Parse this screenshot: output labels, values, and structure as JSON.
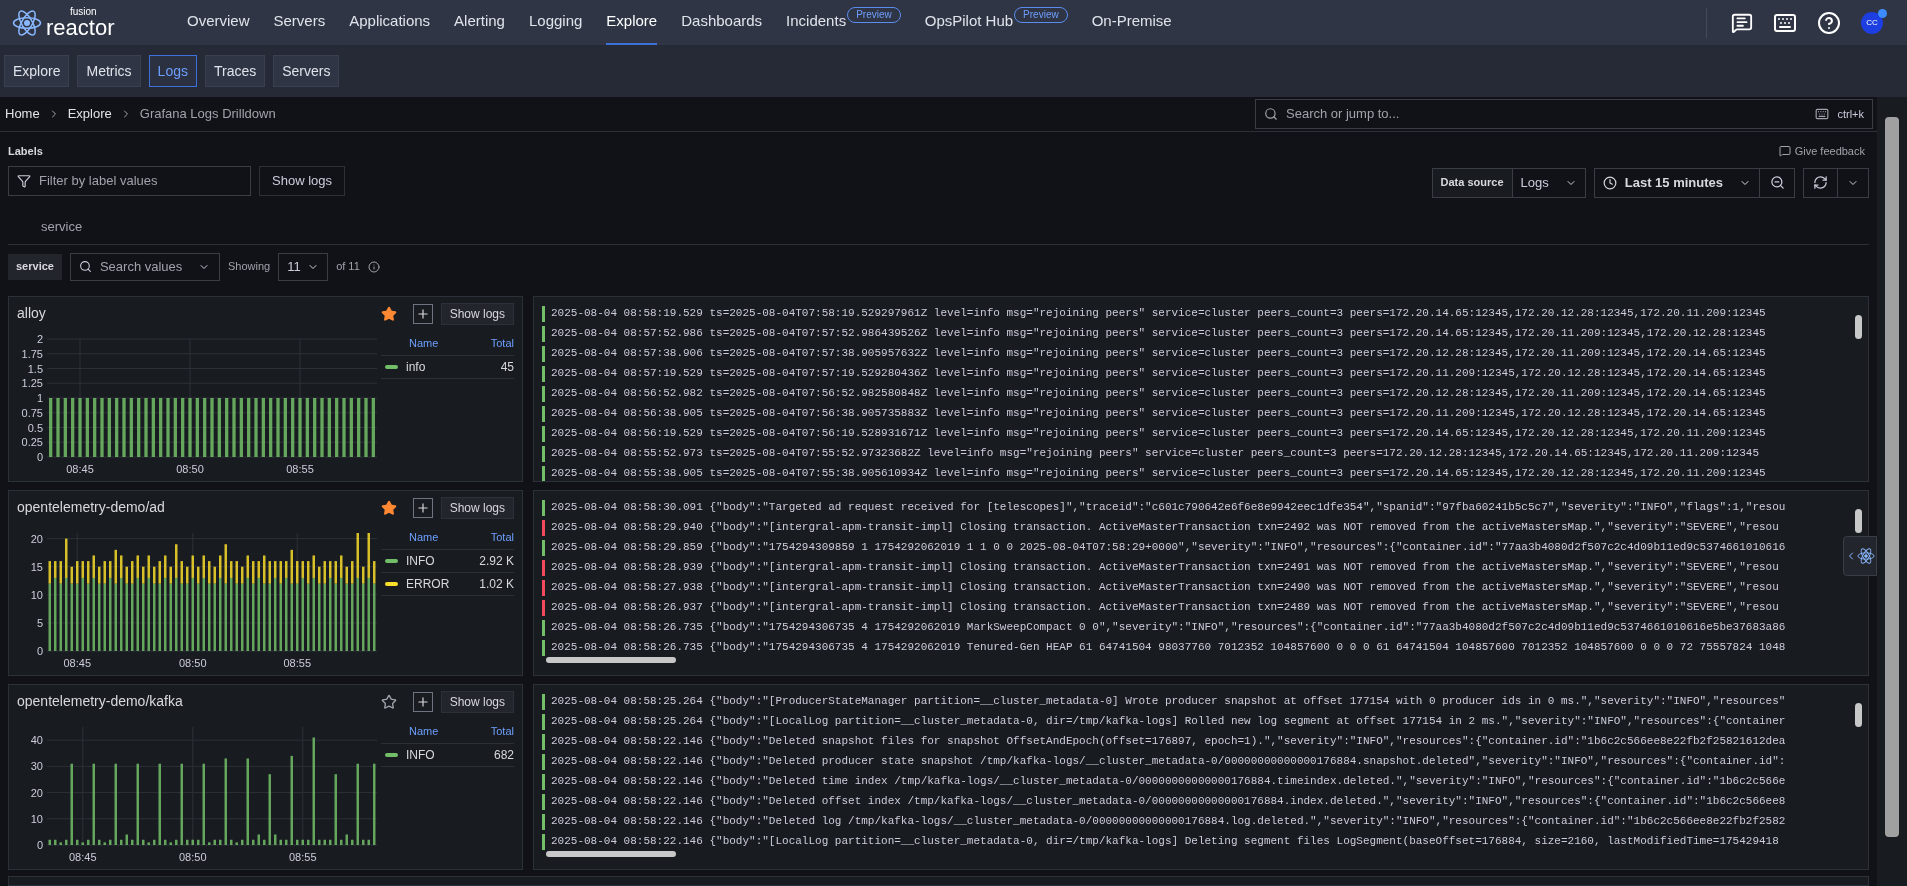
{
  "nav": {
    "logo": {
      "small": "fusion",
      "large": "reactor"
    },
    "items": [
      {
        "label": "Overview",
        "selected": false
      },
      {
        "label": "Servers",
        "selected": false
      },
      {
        "label": "Applications",
        "selected": false
      },
      {
        "label": "Alerting",
        "selected": false
      },
      {
        "label": "Logging",
        "selected": false
      },
      {
        "label": "Explore",
        "selected": true
      },
      {
        "label": "Dashboards",
        "selected": false
      },
      {
        "label": "Incidents",
        "selected": false,
        "badge": "Preview"
      },
      {
        "label": "OpsPilot Hub",
        "selected": false,
        "badge": "Preview"
      },
      {
        "label": "On-Premise",
        "selected": false
      }
    ],
    "avatar": "CC"
  },
  "subnav": [
    {
      "label": "Explore",
      "selected": false
    },
    {
      "label": "Metrics",
      "selected": false
    },
    {
      "label": "Logs",
      "selected": true
    },
    {
      "label": "Traces",
      "selected": false
    },
    {
      "label": "Servers",
      "selected": false
    }
  ],
  "breadcrumbs": [
    "Home",
    "Explore",
    "Grafana Logs Drilldown"
  ],
  "search": {
    "placeholder": "Search or jump to...",
    "shortcut": "ctrl+k"
  },
  "toolbar": {
    "labels_title": "Labels",
    "filter_placeholder": "Filter by label values",
    "show_logs": "Show logs",
    "feedback": "Give feedback",
    "data_source_label": "Data source",
    "data_source": "Logs",
    "time_range": "Last 15 minutes"
  },
  "label_tab": "service",
  "values_bar": {
    "label": "service",
    "search_placeholder": "Search values",
    "showing": "Showing",
    "count": "11",
    "of": "of 11"
  },
  "panels": [
    {
      "title": "alloy",
      "starred": true,
      "show_logs": "Show logs",
      "legend": {
        "columns": [
          "Name",
          "Total"
        ],
        "totals": [
          "45"
        ]
      },
      "chart_data": {
        "type": "bar",
        "stacked": true,
        "grid": true,
        "yticks": [
          0,
          0.25,
          0.5,
          0.75,
          1,
          1.25,
          1.5,
          1.75,
          2
        ],
        "ylim": [
          0,
          2
        ],
        "categories": [
          null,
          null,
          null,
          null,
          "08:45",
          null,
          null,
          null,
          null,
          null,
          null,
          null,
          null,
          null,
          null,
          null,
          null,
          null,
          null,
          "08:50",
          null,
          null,
          null,
          null,
          null,
          null,
          null,
          null,
          null,
          null,
          null,
          null,
          null,
          null,
          "08:55",
          null,
          null,
          null,
          null,
          null,
          null,
          null,
          null,
          null,
          null
        ],
        "series": [
          {
            "name": "info",
            "color": "#73bf69",
            "values": [
              1,
              1,
              1,
              1,
              1,
              1,
              1,
              1,
              1,
              1,
              1,
              1,
              1,
              1,
              1,
              1,
              1,
              1,
              1,
              1,
              1,
              1,
              1,
              1,
              1,
              1,
              1,
              1,
              1,
              1,
              1,
              1,
              1,
              1,
              1,
              1,
              1,
              1,
              1,
              1,
              1,
              1,
              1,
              1,
              1
            ]
          }
        ]
      },
      "logs": [
        {
          "text": "2025-08-04 08:58:19.529 ts=2025-08-04T07:58:19.529297961Z level=info msg=\"rejoining peers\" service=cluster peers_count=3 peers=172.20.14.65:12345,172.20.12.28:12345,172.20.11.209:12345",
          "color": "#73bf69"
        },
        {
          "text": "2025-08-04 08:57:52.986 ts=2025-08-04T07:57:52.986439526Z level=info msg=\"rejoining peers\" service=cluster peers_count=3 peers=172.20.14.65:12345,172.20.11.209:12345,172.20.12.28:12345",
          "color": "#73bf69"
        },
        {
          "text": "2025-08-04 08:57:38.906 ts=2025-08-04T07:57:38.905957632Z level=info msg=\"rejoining peers\" service=cluster peers_count=3 peers=172.20.12.28:12345,172.20.11.209:12345,172.20.14.65:12345",
          "color": "#73bf69"
        },
        {
          "text": "2025-08-04 08:57:19.529 ts=2025-08-04T07:57:19.529280436Z level=info msg=\"rejoining peers\" service=cluster peers_count=3 peers=172.20.11.209:12345,172.20.12.28:12345,172.20.14.65:12345",
          "color": "#73bf69"
        },
        {
          "text": "2025-08-04 08:56:52.982 ts=2025-08-04T07:56:52.982580848Z level=info msg=\"rejoining peers\" service=cluster peers_count=3 peers=172.20.12.28:12345,172.20.11.209:12345,172.20.14.65:12345",
          "color": "#73bf69"
        },
        {
          "text": "2025-08-04 08:56:38.905 ts=2025-08-04T07:56:38.905735883Z level=info msg=\"rejoining peers\" service=cluster peers_count=3 peers=172.20.11.209:12345,172.20.12.28:12345,172.20.14.65:12345",
          "color": "#73bf69"
        },
        {
          "text": "2025-08-04 08:56:19.529 ts=2025-08-04T07:56:19.528931671Z level=info msg=\"rejoining peers\" service=cluster peers_count=3 peers=172.20.14.65:12345,172.20.12.28:12345,172.20.11.209:12345",
          "color": "#73bf69"
        },
        {
          "text": "2025-08-04 08:55:52.973 ts=2025-08-04T07:55:52.97323682Z level=info msg=\"rejoining peers\" service=cluster peers_count=3 peers=172.20.12.28:12345,172.20.14.65:12345,172.20.11.209:12345",
          "color": "#73bf69"
        },
        {
          "text": "2025-08-04 08:55:38.905 ts=2025-08-04T07:55:38.905610934Z level=info msg=\"rejoining peers\" service=cluster peers_count=3 peers=172.20.14.65:12345,172.20.12.28:12345,172.20.11.209:12345",
          "color": "#73bf69"
        }
      ]
    },
    {
      "title": "opentelemetry-demo/ad",
      "starred": true,
      "show_logs": "Show logs",
      "legend": {
        "columns": [
          "Name",
          "Total"
        ],
        "totals": [
          "2.92 K",
          "1.02 K"
        ]
      },
      "chart_data": {
        "type": "bar",
        "stacked": true,
        "grid": true,
        "yticks": [
          0,
          5,
          10,
          15,
          20
        ],
        "ylim": [
          0,
          21
        ],
        "categories": [
          null,
          null,
          null,
          null,
          null,
          "08:45",
          null,
          null,
          null,
          null,
          null,
          null,
          null,
          null,
          null,
          null,
          null,
          null,
          null,
          null,
          null,
          null,
          null,
          null,
          null,
          null,
          "08:50",
          null,
          null,
          null,
          null,
          null,
          null,
          null,
          null,
          null,
          null,
          null,
          null,
          null,
          null,
          null,
          null,
          null,
          null,
          "08:55",
          null,
          null,
          null,
          null,
          null,
          null,
          null,
          null,
          null,
          null,
          null,
          null,
          null,
          null
        ],
        "series": [
          {
            "name": "INFO",
            "color": "#73bf69",
            "values": [
              12,
              13,
              12,
              13,
              12,
              12,
              13,
              12,
              13,
              12,
              12,
              13,
              12,
              13,
              12,
              12,
              13,
              12,
              13,
              12,
              12,
              13,
              12,
              13,
              12,
              12,
              13,
              12,
              13,
              12,
              12,
              13,
              12,
              13,
              12,
              12,
              13,
              12,
              13,
              12,
              12,
              13,
              12,
              13,
              12,
              12,
              13,
              12,
              13,
              12,
              12,
              13,
              12,
              13,
              12,
              12,
              13,
              12,
              13,
              12
            ]
          },
          {
            "name": "ERROR",
            "color": "#fade2a",
            "values": [
              4,
              3,
              4,
              7,
              3,
              4,
              3,
              4,
              4,
              3,
              4,
              3,
              6,
              4,
              3,
              4,
              4,
              3,
              4,
              3,
              4,
              4,
              3,
              6,
              4,
              3,
              4,
              3,
              4,
              4,
              3,
              4,
              7,
              3,
              4,
              3,
              4,
              4,
              3,
              5,
              4,
              3,
              4,
              3,
              6,
              4,
              3,
              4,
              4,
              3,
              4,
              3,
              4,
              4,
              3,
              4,
              8,
              3,
              8,
              4
            ]
          }
        ]
      },
      "logs": [
        {
          "text": "2025-08-04 08:58:30.091 {\"body\":\"Targeted ad request received for [telescopes]\",\"traceid\":\"c601c790642e6f6e8e9942eec1dfe354\",\"spanid\":\"97fba60241b5c5c7\",\"severity\":\"INFO\",\"flags\":1,\"resou",
          "color": "#73bf69"
        },
        {
          "text": "2025-08-04 08:58:29.940 {\"body\":\"[intergral-apm-transit-impl] Closing transaction. ActiveMasterTransaction txn=2492 was NOT removed from the activeMastersMap.\",\"severity\":\"SEVERE\",\"resou",
          "color": "#f2495c"
        },
        {
          "text": "2025-08-04 08:58:29.859 {\"body\":\"1754294309859 1 1754292062019 1 1 0 0 2025-08-04T07:58:29+0000\",\"severity\":\"INFO\",\"resources\":{\"container.id\":\"77aa3b4080d2f507c2c4d09b11ed9c5374661010616",
          "color": "#73bf69"
        },
        {
          "text": "2025-08-04 08:58:28.939 {\"body\":\"[intergral-apm-transit-impl] Closing transaction. ActiveMasterTransaction txn=2491 was NOT removed from the activeMastersMap.\",\"severity\":\"SEVERE\",\"resou",
          "color": "#f2495c"
        },
        {
          "text": "2025-08-04 08:58:27.938 {\"body\":\"[intergral-apm-transit-impl] Closing transaction. ActiveMasterTransaction txn=2490 was NOT removed from the activeMastersMap.\",\"severity\":\"SEVERE\",\"resou",
          "color": "#f2495c"
        },
        {
          "text": "2025-08-04 08:58:26.937 {\"body\":\"[intergral-apm-transit-impl] Closing transaction. ActiveMasterTransaction txn=2489 was NOT removed from the activeMastersMap.\",\"severity\":\"SEVERE\",\"resou",
          "color": "#f2495c"
        },
        {
          "text": "2025-08-04 08:58:26.735 {\"body\":\"1754294306735 4 1754292062019 MarkSweepCompact 0 0\",\"severity\":\"INFO\",\"resources\":{\"container.id\":\"77aa3b4080d2f507c2c4d09b11ed9c5374661010616e5be37683a86",
          "color": "#73bf69"
        },
        {
          "text": "2025-08-04 08:58:26.735 {\"body\":\"1754294306735 4 1754292062019 Tenured-Gen HEAP 61 64741504 98037760 7012352 104857600 0 0 0 61 64741504 104857600 7012352 104857600 0 0 0 72 75557824 1048",
          "color": "#73bf69"
        }
      ]
    },
    {
      "title": "opentelemetry-demo/kafka",
      "starred": false,
      "show_logs": "Show logs",
      "legend": {
        "columns": [
          "Name",
          "Total"
        ],
        "totals": [
          "682"
        ]
      },
      "chart_data": {
        "type": "bar",
        "stacked": true,
        "grid": true,
        "yticks": [
          0,
          10,
          20,
          30,
          40
        ],
        "ylim": [
          0,
          45
        ],
        "categories": [
          null,
          null,
          null,
          null,
          null,
          null,
          "08:45",
          null,
          null,
          null,
          null,
          null,
          null,
          null,
          null,
          null,
          null,
          null,
          null,
          null,
          null,
          null,
          null,
          null,
          null,
          null,
          "08:50",
          null,
          null,
          null,
          null,
          null,
          null,
          null,
          null,
          null,
          null,
          null,
          null,
          null,
          null,
          null,
          null,
          null,
          null,
          null,
          "08:55",
          null,
          null,
          null,
          null,
          null,
          null,
          null,
          null,
          null,
          null,
          null,
          null,
          null
        ],
        "series": [
          {
            "name": "INFO",
            "color": "#73bf69",
            "values": [
              2,
              2,
              1,
              2,
              31,
              2,
              1,
              2,
              31,
              2,
              1,
              2,
              31,
              2,
              4,
              2,
              31,
              2,
              1,
              2,
              31,
              2,
              1,
              2,
              31,
              2,
              2,
              2,
              31,
              1,
              2,
              2,
              33,
              2,
              1,
              2,
              33,
              2,
              4,
              2,
              27,
              4,
              2,
              2,
              34,
              2,
              2,
              2,
              41,
              2,
              2,
              2,
              27,
              2,
              4,
              2,
              31,
              2,
              2,
              31
            ]
          }
        ]
      },
      "logs": [
        {
          "text": "2025-08-04 08:58:25.264 {\"body\":\"[ProducerStateManager partition=__cluster_metadata-0] Wrote producer snapshot at offset 177154 with 0 producer ids in 0 ms.\",\"severity\":\"INFO\",\"resources\"",
          "color": "#73bf69"
        },
        {
          "text": "2025-08-04 08:58:25.264 {\"body\":\"[LocalLog partition=__cluster_metadata-0, dir=/tmp/kafka-logs] Rolled new log segment at offset 177154 in 2 ms.\",\"severity\":\"INFO\",\"resources\":{\"container",
          "color": "#73bf69"
        },
        {
          "text": "2025-08-04 08:58:22.146 {\"body\":\"Deleted snapshot files for snapshot OffsetAndEpoch(offset=176897, epoch=1).\",\"severity\":\"INFO\",\"resources\":{\"container.id\":\"1b6c2c566ee8e22fb2f25821612dea",
          "color": "#73bf69"
        },
        {
          "text": "2025-08-04 08:58:22.146 {\"body\":\"Deleted producer state snapshot /tmp/kafka-logs/__cluster_metadata-0/00000000000000176884.snapshot.deleted\",\"severity\":\"INFO\",\"resources\":{\"container.id\":",
          "color": "#73bf69"
        },
        {
          "text": "2025-08-04 08:58:22.146 {\"body\":\"Deleted time index /tmp/kafka-logs/__cluster_metadata-0/00000000000000176884.timeindex.deleted.\",\"severity\":\"INFO\",\"resources\":{\"container.id\":\"1b6c2c566e",
          "color": "#73bf69"
        },
        {
          "text": "2025-08-04 08:58:22.146 {\"body\":\"Deleted offset index /tmp/kafka-logs/__cluster_metadata-0/00000000000000176884.index.deleted.\",\"severity\":\"INFO\",\"resources\":{\"container.id\":\"1b6c2c566ee8",
          "color": "#73bf69"
        },
        {
          "text": "2025-08-04 08:58:22.146 {\"body\":\"Deleted log /tmp/kafka-logs/__cluster_metadata-0/00000000000000176884.log.deleted.\",\"severity\":\"INFO\",\"resources\":{\"container.id\":\"1b6c2c566ee8e22fb2f2582",
          "color": "#73bf69"
        },
        {
          "text": "2025-08-04 08:58:22.146 {\"body\":\"[LocalLog partition=__cluster_metadata-0, dir=/tmp/kafka-logs] Deleting segment files LogSegment(baseOffset=176884, size=2160, lastModifiedTime=175429418",
          "color": "#73bf69"
        }
      ]
    }
  ]
}
